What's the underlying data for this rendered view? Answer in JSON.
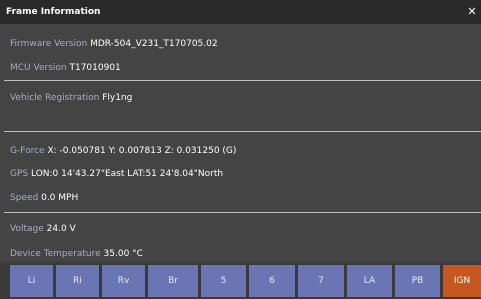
{
  "window": {
    "title": "Frame Information",
    "close_glyph": "✕"
  },
  "info": {
    "firmware": {
      "label": "Firmware Version",
      "value": "MDR-504_V231_T170705.02"
    },
    "mcu": {
      "label": "MCU Version",
      "value": "T17010901"
    },
    "registration": {
      "label": "Vehicle Registration",
      "value": "Fly1ng"
    },
    "gforce": {
      "label": "G-Force",
      "value": "X: -0.050781 Y: 0.007813 Z: 0.031250 (G)"
    },
    "gps": {
      "label": "GPS",
      "value": "LON:0 14'43.27\"East  LAT:51 24'8.04\"North"
    },
    "speed": {
      "label": "Speed",
      "value": "0.0 MPH"
    },
    "voltage": {
      "label": "Voltage",
      "value": "24.0 V"
    },
    "temperature": {
      "label": "Device Temperature",
      "value": "35.00 °C"
    }
  },
  "buttons": [
    "Li",
    "Ri",
    "Rv",
    "Br",
    "5",
    "6",
    "7",
    "LA",
    "PB",
    "IGN"
  ],
  "colors": {
    "accent_button": "#6a76b4",
    "active_button": "#c5571f",
    "label_text": "#a9acc8"
  }
}
